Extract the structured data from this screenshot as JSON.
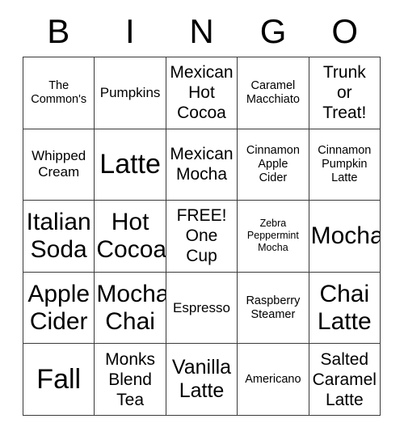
{
  "card": {
    "title_letters": [
      "B",
      "I",
      "N",
      "G",
      "O"
    ],
    "columns": 5,
    "rows": 5,
    "grid_line_color": "#3a3a3a",
    "background_color": "#ffffff",
    "text_color": "#000000",
    "cells": [
      [
        {
          "label": "The\nCommon's",
          "size": "sm",
          "free": false
        },
        {
          "label": "Pumpkins",
          "size": "md",
          "free": false
        },
        {
          "label": "Mexican\nHot\nCocoa",
          "size": "lg",
          "free": false
        },
        {
          "label": "Caramel\nMacchiato",
          "size": "sm",
          "free": false
        },
        {
          "label": "Trunk\nor\nTreat!",
          "size": "lg",
          "free": false
        }
      ],
      [
        {
          "label": "Whipped\nCream",
          "size": "md",
          "free": false
        },
        {
          "label": "Latte",
          "size": "h",
          "free": false
        },
        {
          "label": "Mexican\nMocha",
          "size": "lg",
          "free": false
        },
        {
          "label": "Cinnamon\nApple\nCider",
          "size": "sm",
          "free": false
        },
        {
          "label": "Cinnamon\nPumpkin\nLatte",
          "size": "sm",
          "free": false
        }
      ],
      [
        {
          "label": "Italian\nSoda",
          "size": "xxl",
          "free": false
        },
        {
          "label": "Hot\nCocoa",
          "size": "xxl",
          "free": false
        },
        {
          "label": "FREE!\nOne\nCup",
          "size": "lg",
          "free": true
        },
        {
          "label": "Zebra\nPeppermint\nMocha",
          "size": "xs",
          "free": false
        },
        {
          "label": "Mocha",
          "size": "xxl",
          "free": false
        }
      ],
      [
        {
          "label": "Apple\nCider",
          "size": "xxl",
          "free": false
        },
        {
          "label": "Mocha\nChai",
          "size": "xxl",
          "free": false
        },
        {
          "label": "Espresso",
          "size": "md",
          "free": false
        },
        {
          "label": "Raspberry\nSteamer",
          "size": "sm",
          "free": false
        },
        {
          "label": "Chai\nLatte",
          "size": "xxl",
          "free": false
        }
      ],
      [
        {
          "label": "Fall",
          "size": "h",
          "free": false
        },
        {
          "label": "Monks\nBlend\nTea",
          "size": "lg",
          "free": false
        },
        {
          "label": "Vanilla\nLatte",
          "size": "xl",
          "free": false
        },
        {
          "label": "Americano",
          "size": "sm",
          "free": false
        },
        {
          "label": "Salted\nCaramel\nLatte",
          "size": "lg",
          "free": false
        }
      ]
    ]
  }
}
